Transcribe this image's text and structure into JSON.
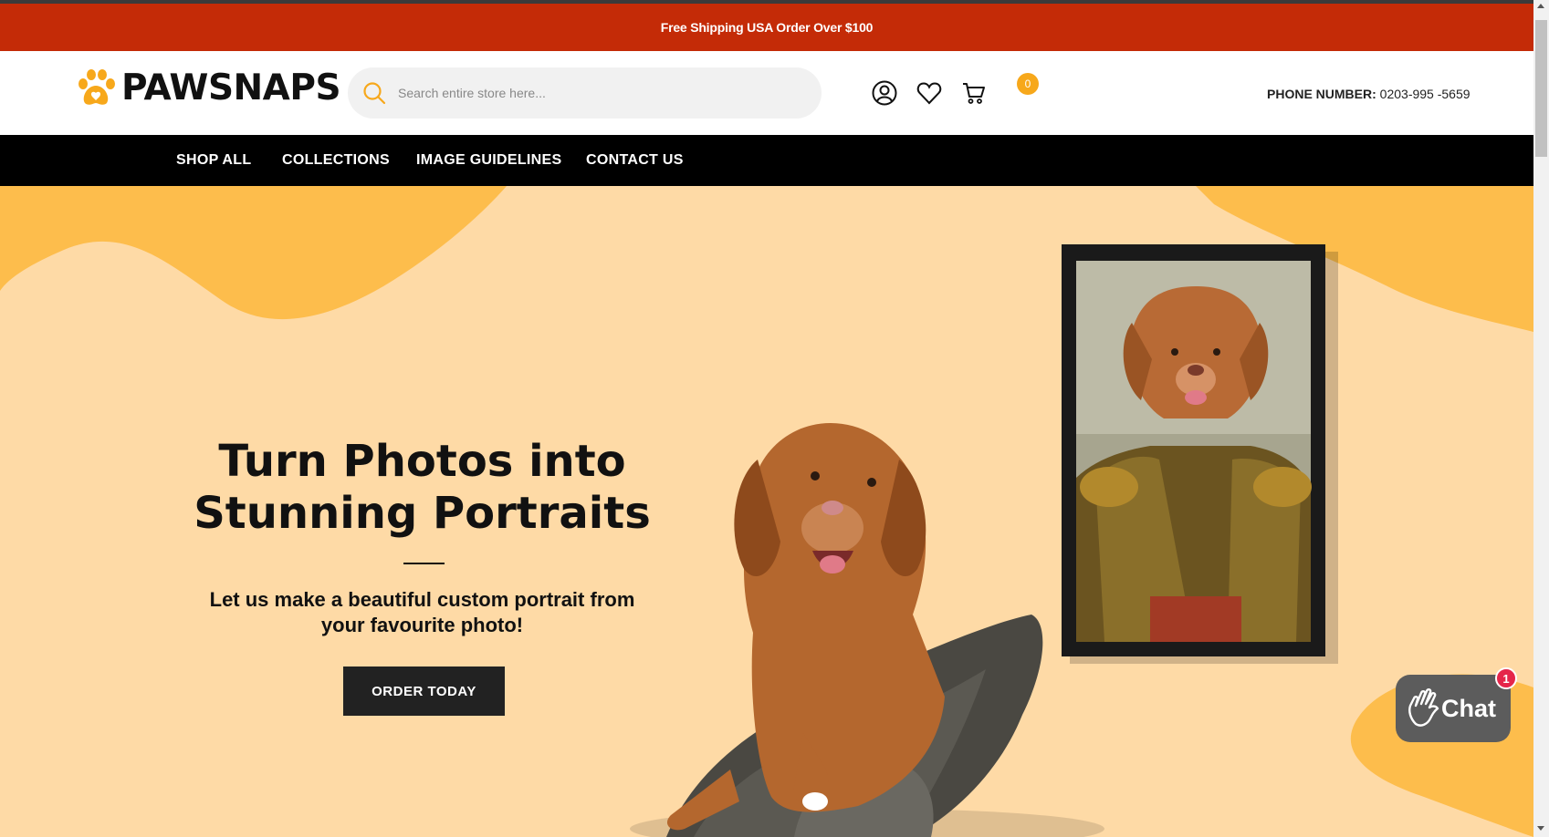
{
  "announcement": "Free Shipping USA Order Over $100",
  "logo": {
    "text": "PAWSNAPS"
  },
  "search": {
    "placeholder": "Search entire store here..."
  },
  "header": {
    "cart_count": "0",
    "phone_label": "PHONE NUMBER:",
    "phone_number": "0203-995 -5659"
  },
  "nav": {
    "items": [
      {
        "label": "SHOP ALL"
      },
      {
        "label": "COLLECTIONS"
      },
      {
        "label": "IMAGE GUIDELINES"
      },
      {
        "label": "CONTACT US"
      }
    ]
  },
  "hero": {
    "headline_line1": "Turn Photos into",
    "headline_line2": "Stunning Portraits",
    "subtext_line1": "Let us make a beautiful custom portrait from",
    "subtext_line2": "your favourite photo!",
    "cta_label": "ORDER TODAY"
  },
  "chat": {
    "label": "Chat",
    "badge": "1"
  },
  "colors": {
    "announcement_bg": "#c42b07",
    "accent": "#f7a81b",
    "hero_bg": "#fedaa6",
    "hero_blob": "#fdbd4c",
    "nav_bg": "#000000"
  }
}
